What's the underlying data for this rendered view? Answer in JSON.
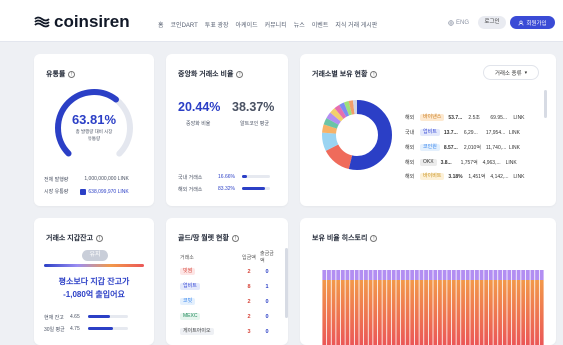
{
  "header": {
    "logo_text": "coinsiren",
    "nav": [
      "홈",
      "코인DART",
      "투표 광장",
      "아케이드",
      "커뮤니티",
      "뉴스",
      "이벤트",
      "지식 거래 게시판"
    ],
    "lang": "ENG",
    "login": "로그인",
    "join": "회원가입"
  },
  "distribution": {
    "title": "유통률",
    "percent": "63.81%",
    "percent_value": 63.81,
    "desc_line1": "총 발행량 대비 시장",
    "desc_line2": "유통량",
    "total_label": "전체 발행량",
    "total_value": "1,000,000,000 LINK",
    "market_label": "시장 유통량",
    "market_value": "638,099,970 LINK"
  },
  "domestic": {
    "title": "중앙화 거래소 비율",
    "pct1": "20.44%",
    "pct2": "38.37%",
    "label1": "중앙화 비율",
    "label2": "알트코인 평균",
    "rows": [
      {
        "label": "국내 거래소",
        "value": "16.66%",
        "fill": 0.17,
        "color": "#2b3fc6"
      },
      {
        "label": "해외 거래소",
        "value": "83.32%",
        "fill": 0.83,
        "color": "#2b3fc6"
      }
    ]
  },
  "exchange": {
    "title": "거래소별 보유 현황",
    "dropdown": "거래소 종류",
    "rows": [
      {
        "region": "해외",
        "name": "바이낸스",
        "pct": "53.7...",
        "v1": "2.5조",
        "v2": "69.95...",
        "unit": "LINK",
        "tag_bg": "#fde9d0",
        "tag_fg": "#c97b1d"
      },
      {
        "region": "국내",
        "name": "업비트",
        "pct": "13.7...",
        "v1": "6,29...",
        "v2": "17,954...",
        "unit": "LINK",
        "tag_bg": "#e3e8fb",
        "tag_fg": "#3a4bd6"
      },
      {
        "region": "해외",
        "name": "코인원",
        "pct": "8.57...",
        "v1": "2,010억",
        "v2": "11,740,...",
        "unit": "LINK",
        "tag_bg": "#e4f0fd",
        "tag_fg": "#2f80ed"
      },
      {
        "region": "해외",
        "name": "OKX",
        "pct": "3.8...",
        "v1": "1,757억",
        "v2": "4,963,...",
        "unit": "LINK",
        "tag_bg": "#ececec",
        "tag_fg": "#333"
      },
      {
        "region": "해외",
        "name": "바이비트",
        "pct": "3.18%",
        "v1": "1,451억",
        "v2": "4,142,...",
        "unit": "LINK",
        "tag_bg": "#fdf1d8",
        "tag_fg": "#c9921d"
      }
    ],
    "donut_colors": [
      "#2b3fc6",
      "#ef6b5b",
      "#9ad4f2",
      "#f7b267",
      "#6bc4a6",
      "#b28ef2",
      "#f2d06b",
      "#e66fb0",
      "#7c8bf2",
      "#9ee07a",
      "#f29e6b",
      "#cfd5e6"
    ],
    "donut_values": [
      53.7,
      13.7,
      8.57,
      3.8,
      3.18,
      3.0,
      2.8,
      2.6,
      2.4,
      2.2,
      2.0,
      2.05
    ]
  },
  "wallet": {
    "title": "거래소 지갑잔고",
    "status": "유지",
    "headline1": "평소보다 지갑 잔고가",
    "headline2": "-1,080억 출입어요",
    "rows": [
      {
        "label": "현재 잔고",
        "value": "4.65",
        "fill": 0.55
      },
      {
        "label": "30일 평균",
        "value": "4.75",
        "fill": 0.62
      }
    ]
  },
  "flow": {
    "title": "골드/땅 월렛 현황",
    "headers": [
      "거래소",
      "입금액",
      "출금금액"
    ],
    "rows": [
      {
        "name": "빗썸",
        "in": "2",
        "out": "0",
        "tag_bg": "#fde6e6",
        "tag_fg": "#d6453a"
      },
      {
        "name": "업비트",
        "in": "8",
        "out": "1",
        "tag_bg": "#e3e8fb",
        "tag_fg": "#3a4bd6"
      },
      {
        "name": "코빗",
        "in": "2",
        "out": "0",
        "tag_bg": "#e4f0fd",
        "tag_fg": "#2f80ed"
      },
      {
        "name": "MEXC",
        "in": "2",
        "out": "0",
        "tag_bg": "#e6f5ee",
        "tag_fg": "#1f8a5a"
      },
      {
        "name": "게이트아이오",
        "in": "3",
        "out": "0",
        "tag_bg": "#eef0f4",
        "tag_fg": "#444"
      }
    ]
  },
  "history": {
    "title": "보유 비율 히스토리",
    "bar_top_color": "#b28ef2",
    "bar_gradient": [
      "#f2994a",
      "#eb5757"
    ],
    "bar_count": 48
  }
}
